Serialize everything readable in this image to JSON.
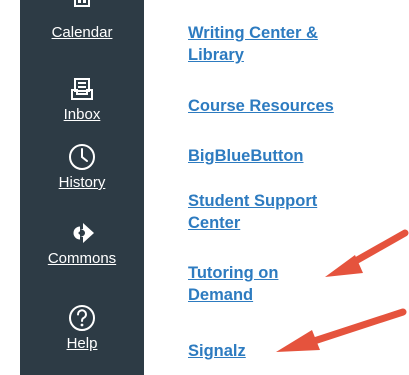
{
  "sidebar": {
    "items": [
      {
        "label": "Calendar",
        "icon": "calendar-icon"
      },
      {
        "label": "Inbox",
        "icon": "inbox-icon"
      },
      {
        "label": "History",
        "icon": "clock-icon"
      },
      {
        "label": "Commons",
        "icon": "commons-arrow-icon"
      },
      {
        "label": "Help",
        "icon": "help-question-icon"
      }
    ]
  },
  "links": [
    {
      "line1": "Writing Center &",
      "line2": "Library"
    },
    {
      "line1": "Course Resources",
      "line2": ""
    },
    {
      "line1": "BigBlueButton",
      "line2": ""
    },
    {
      "line1": "Student Support",
      "line2": "Center"
    },
    {
      "line1": "Tutoring on",
      "line2": "Demand"
    },
    {
      "line1": "Signalz",
      "line2": ""
    }
  ],
  "colors": {
    "sidebar_bg": "#2d3b45",
    "link": "#2d7bc0",
    "arrow": "#e5533d"
  }
}
